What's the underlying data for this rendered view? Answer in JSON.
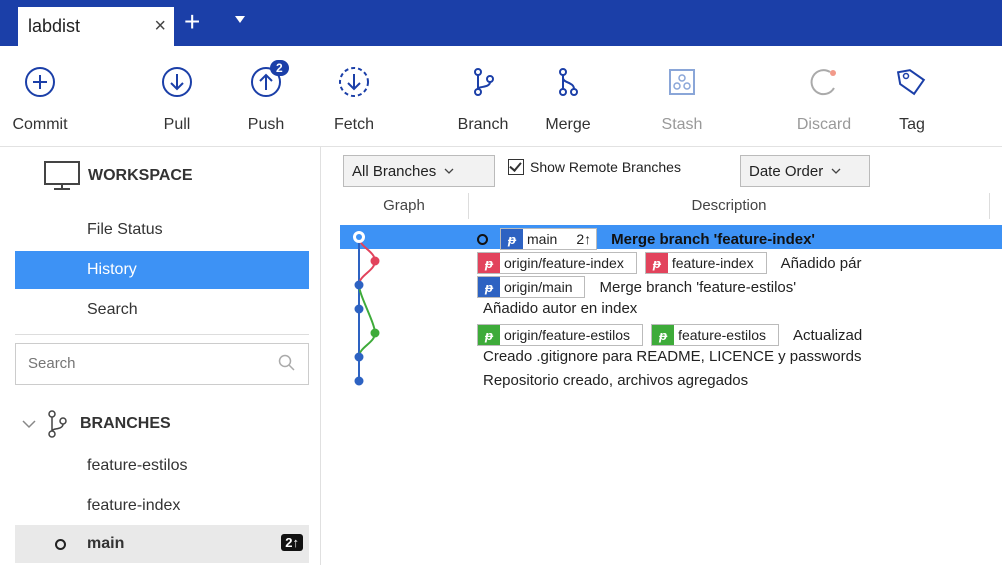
{
  "window": {
    "tab_title": "labdist",
    "tab_close": "×",
    "new_tab": "+"
  },
  "toolbar": {
    "commit": "Commit",
    "pull": "Pull",
    "push": "Push",
    "push_badge": "2",
    "fetch": "Fetch",
    "branch": "Branch",
    "merge": "Merge",
    "stash": "Stash",
    "discard": "Discard",
    "tag": "Tag"
  },
  "sidebar": {
    "workspace_title": "WORKSPACE",
    "items": [
      {
        "label": "File Status"
      },
      {
        "label": "History"
      },
      {
        "label": "Search"
      }
    ],
    "search_placeholder": "Search",
    "branches_title": "BRANCHES",
    "branches": [
      {
        "label": "feature-estilos"
      },
      {
        "label": "feature-index"
      },
      {
        "label": "main",
        "badge": "2↑"
      }
    ]
  },
  "main": {
    "branch_filter": "All Branches",
    "show_remote": "Show Remote Branches",
    "order": "Date Order",
    "col_graph": "Graph",
    "col_description": "Description",
    "commits": [
      {
        "tags": [
          {
            "name": "main",
            "color": "blue",
            "ahead": "2↑"
          }
        ],
        "message": "Merge branch 'feature-index'"
      },
      {
        "tags": [
          {
            "name": "origin/feature-index",
            "color": "red"
          },
          {
            "name": "feature-index",
            "color": "red"
          }
        ],
        "message": "Añadido pár"
      },
      {
        "tags": [
          {
            "name": "origin/main",
            "color": "blue"
          }
        ],
        "message": "Merge branch 'feature-estilos'"
      },
      {
        "tags": [],
        "message": "Añadido autor en index"
      },
      {
        "tags": [
          {
            "name": "origin/feature-estilos",
            "color": "green"
          },
          {
            "name": "feature-estilos",
            "color": "green"
          }
        ],
        "message": "Actualizad"
      },
      {
        "tags": [],
        "message": "Creado .gitignore para README, LICENCE y passwords"
      },
      {
        "tags": [],
        "message": "Repositorio creado, archivos agregados"
      }
    ]
  },
  "colors": {
    "accent": "#1b3fa8",
    "selection": "#3d92f5",
    "branch_blue": "#2d62c2",
    "branch_red": "#e2435c",
    "branch_green": "#3eab3a"
  }
}
